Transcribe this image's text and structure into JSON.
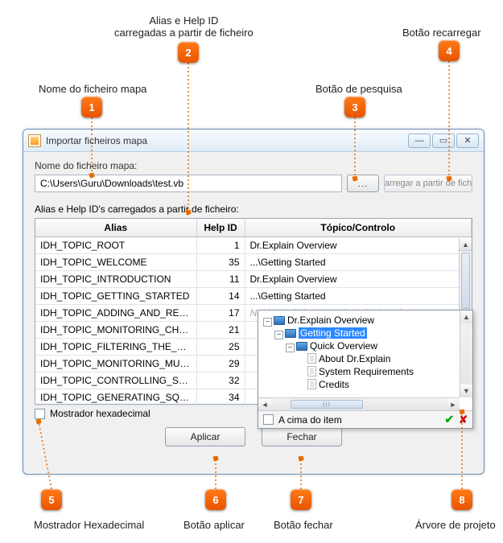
{
  "annotations": {
    "a1": {
      "num": "1",
      "label": "Nome do ficheiro mapa"
    },
    "a2": {
      "num": "2",
      "label": "Alias e Help ID\ncarregadas a partir de ficheiro"
    },
    "a3": {
      "num": "3",
      "label": "Botão de pesquisa"
    },
    "a4": {
      "num": "4",
      "label": "Botão recarregar"
    },
    "a5": {
      "num": "5",
      "label": "Mostrador Hexadecimal"
    },
    "a6": {
      "num": "6",
      "label": "Botão aplicar"
    },
    "a7": {
      "num": "7",
      "label": "Botão fechar"
    },
    "a8": {
      "num": "8",
      "label": "Árvore de projeto"
    }
  },
  "window": {
    "title": "Importar ficheiros mapa",
    "field_label": "Nome do ficheiro mapa:",
    "path_value": "C:\\Users\\Guru\\Downloads\\test.vb",
    "browse_label": "...",
    "reload_label": "arregar a partir de fich",
    "section_label": "Alias e Help ID's carregados a partir de ficheiro:",
    "columns": {
      "alias": "Alias",
      "helpid": "Help ID",
      "topic": "Tópico/Controlo"
    },
    "rows": [
      {
        "alias": "IDH_TOPIC_ROOT",
        "hid": "1",
        "topic": "Dr.Explain Overview"
      },
      {
        "alias": "IDH_TOPIC_WELCOME",
        "hid": "35",
        "topic": "...\\Getting Started"
      },
      {
        "alias": "IDH_TOPIC_INTRODUCTION",
        "hid": "11",
        "topic": "Dr.Explain Overview"
      },
      {
        "alias": "IDH_TOPIC_GETTING_STARTED",
        "hid": "14",
        "topic": "...\\Getting Started"
      },
      {
        "alias": "IDH_TOPIC_ADDING_AND_REM...",
        "hid": "17",
        "topic": "Nenhum tópico/controlo selecionado",
        "placeholder": true
      },
      {
        "alias": "IDH_TOPIC_MONITORING_CHA...",
        "hid": "21",
        "topic": ""
      },
      {
        "alias": "IDH_TOPIC_FILTERING_THE_VIEW",
        "hid": "25",
        "topic": ""
      },
      {
        "alias": "IDH_TOPIC_MONITORING_MUL...",
        "hid": "29",
        "topic": ""
      },
      {
        "alias": "IDH_TOPIC_CONTROLLING_SCRI...",
        "hid": "32",
        "topic": ""
      },
      {
        "alias": "IDH_TOPIC_GENERATING_SQL_S...",
        "hid": "34",
        "topic": ""
      }
    ],
    "hex_checkbox": "Mostrador hexadecimal",
    "apply": "Aplicar",
    "close": "Fechar"
  },
  "tree": {
    "root": "Dr.Explain Overview",
    "n1": "Getting Started",
    "n2": "Quick Overview",
    "n2a": "About Dr.Explain",
    "n2b": "System Requirements",
    "n2c": "Credits",
    "footer_cb": "A cima do item",
    "hthumb": "III"
  }
}
